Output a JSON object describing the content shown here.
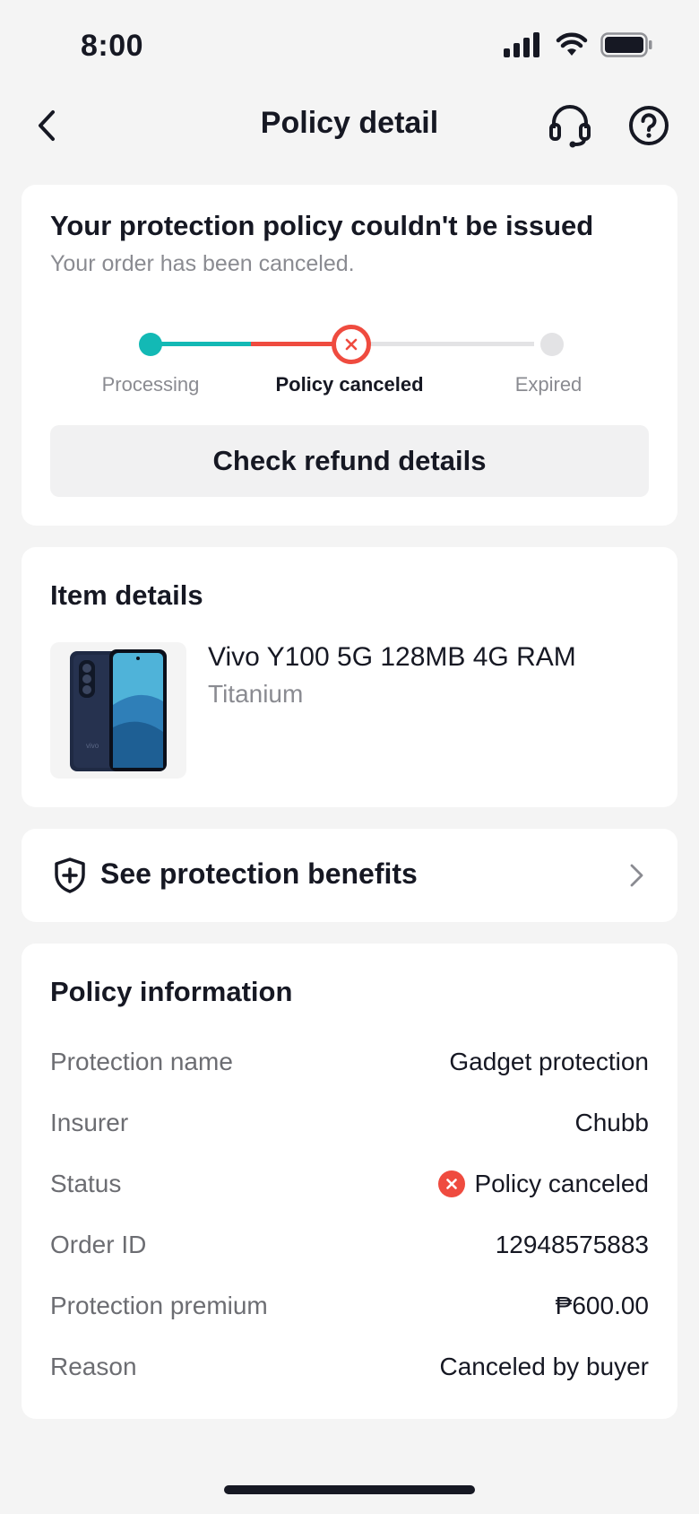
{
  "status_bar": {
    "time": "8:00"
  },
  "nav": {
    "title": "Policy detail"
  },
  "status_card": {
    "title": "Your protection policy couldn't be issued",
    "subtitle": "Your order has been canceled.",
    "steps": [
      {
        "label": "Processing"
      },
      {
        "label": "Policy canceled"
      },
      {
        "label": "Expired"
      }
    ],
    "refund_button": "Check refund details",
    "colors": {
      "done": "#13b9b5",
      "canceled": "#ef4b3f",
      "pending": "#e3e3e5"
    }
  },
  "item_card": {
    "title": "Item details",
    "product_name": "Vivo Y100 5G 128MB 4G RAM",
    "variant": "Titanium"
  },
  "benefits": {
    "label": "See protection benefits"
  },
  "policy_info": {
    "title": "Policy information",
    "rows": [
      {
        "key": "Protection name",
        "value": "Gadget protection"
      },
      {
        "key": "Insurer",
        "value": "Chubb"
      },
      {
        "key": "Status",
        "value": "Policy canceled"
      },
      {
        "key": "Order ID",
        "value": "12948575883"
      },
      {
        "key": "Protection premium",
        "value": "₱600.00"
      },
      {
        "key": "Reason",
        "value": "Canceled by buyer"
      }
    ]
  }
}
